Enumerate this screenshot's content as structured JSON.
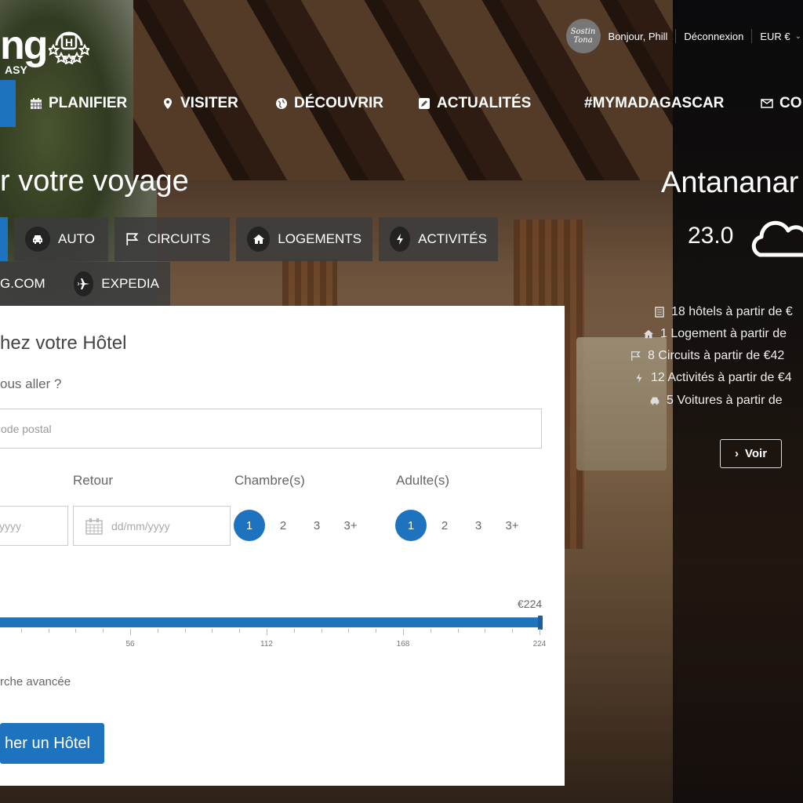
{
  "header": {
    "logo_text": "ng",
    "logo_sub": "ASY",
    "logo_badge": "H",
    "avatar_text": "Sostin Tona",
    "greeting": "Bonjour, Phill",
    "logout": "Déconnexion",
    "currency": "EUR €"
  },
  "nav": [
    {
      "label": "PLANIFIER",
      "icon": "calendar-icon"
    },
    {
      "label": "VISITER",
      "icon": "map-marker-icon"
    },
    {
      "label": "DÉCOUVRIR",
      "icon": "globe-icon"
    },
    {
      "label": "ACTUALITÉS",
      "icon": "edit-icon"
    },
    {
      "label": "#MYMADAGASCAR",
      "icon": ""
    },
    {
      "label": "CO",
      "icon": "envelope-icon"
    }
  ],
  "hero": {
    "title": "r votre voyage"
  },
  "tabs": [
    {
      "label": "AUTO",
      "icon": "car-icon"
    },
    {
      "label": "CIRCUITS",
      "icon": "flag-icon"
    },
    {
      "label": "LOGEMENTS",
      "icon": "home-icon"
    },
    {
      "label": "ACTIVITÉS",
      "icon": "bolt-icon"
    },
    {
      "label": "G.COM",
      "icon": ""
    },
    {
      "label": "EXPEDIA",
      "icon": "plane-icon"
    }
  ],
  "weather": {
    "city": "Antananar",
    "temperature": "23.0",
    "icon": "cloud-icon"
  },
  "stats": [
    {
      "text": "18 hôtels à partir de €",
      "icon": "building-icon"
    },
    {
      "text": "1 Logement à partir de",
      "icon": "home-icon"
    },
    {
      "text": "8 Circuits à partir de €42",
      "icon": "flag-icon"
    },
    {
      "text": "12 Activités à partir de €4",
      "icon": "bolt-icon"
    },
    {
      "text": "5 Voitures à partir de",
      "icon": "car-icon"
    }
  ],
  "voir_button": "Voir",
  "search_panel": {
    "title": "hez votre Hôtel",
    "destination_label": "ous aller ?",
    "destination_placeholder": "ode postal",
    "checkin_placeholder": "yyyy",
    "return_label": "Retour",
    "return_placeholder": "dd/mm/yyyy",
    "rooms_label": "Chambre(s)",
    "rooms_options": [
      "1",
      "2",
      "3",
      "3+"
    ],
    "rooms_selected": "1",
    "adults_label": "Adulte(s)",
    "adults_options": [
      "1",
      "2",
      "3",
      "3+"
    ],
    "adults_selected": "1",
    "price_max_label": "€224",
    "price_slider": {
      "min": 0,
      "max": 224,
      "value": 224
    },
    "tick_labels": [
      "56",
      "112",
      "168",
      "224"
    ],
    "advanced_search": "rche avancée",
    "submit": "her un Hôtel"
  }
}
